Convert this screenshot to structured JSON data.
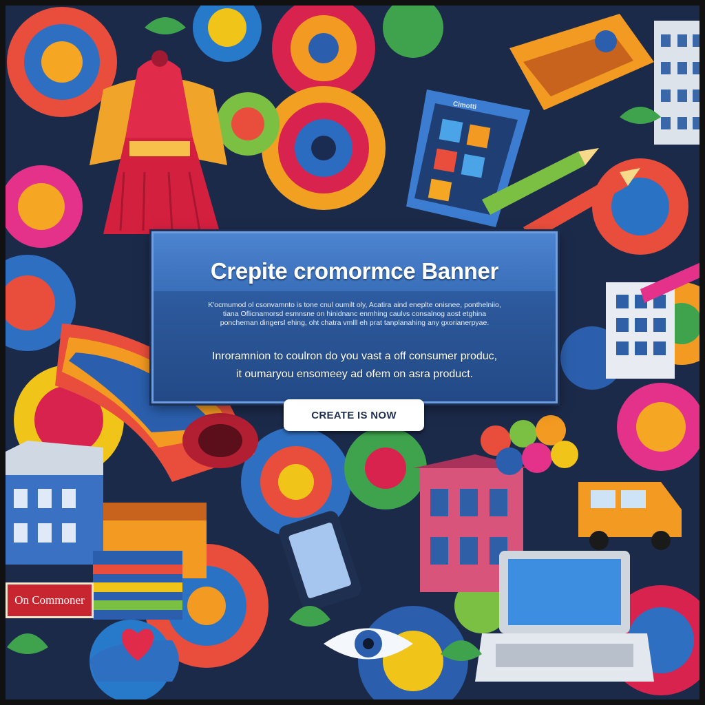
{
  "banner": {
    "headline": "Crepite cromormce Banner",
    "fine_print": [
      "K'ocmumod ol csonvamnto is tone cnul oumilt oly, Acatira aind eneplte onisnee, ponthelniio,",
      "tiana Oflicnamorsd esmnsne on hinidnanc enmhing caulvs consalnog aost etghina",
      "poncheman dingersl ehing, oht chatra vmlll eh prat tanplanahing any gxorianerpyae."
    ],
    "body_lines": [
      "Inroramnion to coulron do you vast a off consumer produc,",
      "it oumaryou ensomeey ad ofem on asra product."
    ],
    "cta_label": "CREATE IS NOW"
  },
  "scene_text": {
    "storefront_sign": "On Commoner",
    "device_label": "Cimotti"
  },
  "colors": {
    "panel_blue": "#2a5596",
    "panel_border": "#6f9ee0",
    "button_bg": "#ffffff",
    "button_text": "#1e2f4f",
    "sign_red": "#c7252f"
  }
}
